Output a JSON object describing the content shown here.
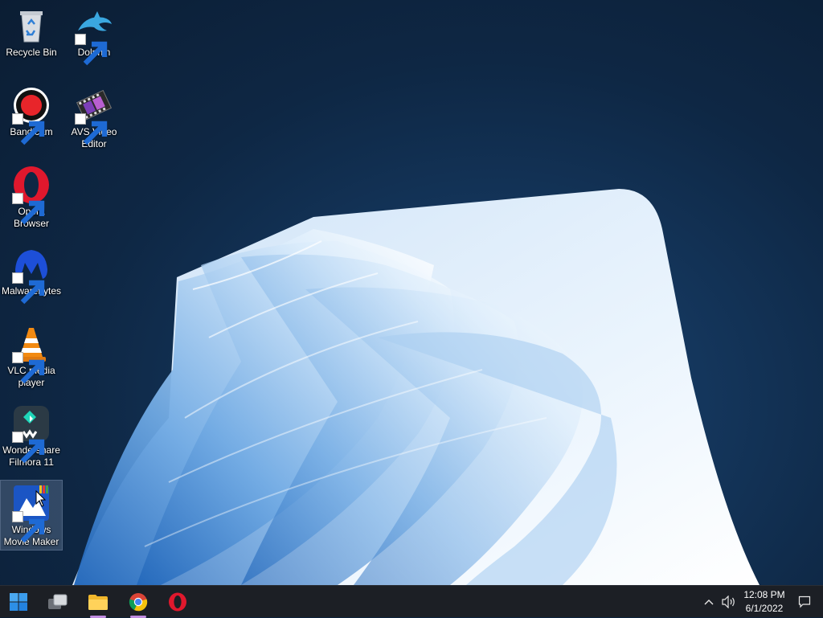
{
  "desktop": {
    "icons": [
      {
        "name": "recycle-bin",
        "label": "Recycle Bin",
        "icon": "recycle-bin-icon",
        "shortcut": false
      },
      {
        "name": "dolphin",
        "label": "Dolphin",
        "icon": "dolphin-icon",
        "shortcut": true
      },
      {
        "name": "bandicam",
        "label": "Bandicam",
        "icon": "bandicam-icon",
        "shortcut": true
      },
      {
        "name": "avs-video-editor",
        "label": "AVS Video Editor",
        "icon": "film-strip-icon",
        "shortcut": true
      },
      {
        "name": "opera-browser",
        "label": "Opera Browser",
        "icon": "opera-icon",
        "shortcut": true
      },
      {
        "name": "malwarebytes",
        "label": "Malwarebytes",
        "icon": "malwarebytes-icon",
        "shortcut": true
      },
      {
        "name": "vlc-media-player",
        "label": "VLC media player",
        "icon": "vlc-cone-icon",
        "shortcut": true
      },
      {
        "name": "wondershare-filmora",
        "label": "Wondershare Filmora 11",
        "icon": "filmora-icon",
        "shortcut": true
      },
      {
        "name": "windows-movie-maker",
        "label": "Windows Movie Maker",
        "icon": "movie-maker-icon",
        "shortcut": true,
        "selected": true
      }
    ]
  },
  "taskbar": {
    "apps": [
      {
        "name": "start-button",
        "icon": "windows-logo-icon"
      },
      {
        "name": "task-view-button",
        "icon": "task-view-icon"
      },
      {
        "name": "file-explorer-button",
        "icon": "folder-icon",
        "running": true
      },
      {
        "name": "chrome-button",
        "icon": "chrome-icon",
        "running": true
      },
      {
        "name": "opera-button",
        "icon": "opera-icon"
      }
    ],
    "tray": {
      "chevron_icon": "chevron-up-icon",
      "volume_icon": "speaker-icon",
      "notifications_icon": "notification-icon"
    },
    "clock": {
      "time": "12:08 PM",
      "date": "6/1/2022"
    }
  },
  "colors": {
    "background": "#0e2744",
    "taskbar": "#1c1f25",
    "selection": "#7a8fb0"
  }
}
